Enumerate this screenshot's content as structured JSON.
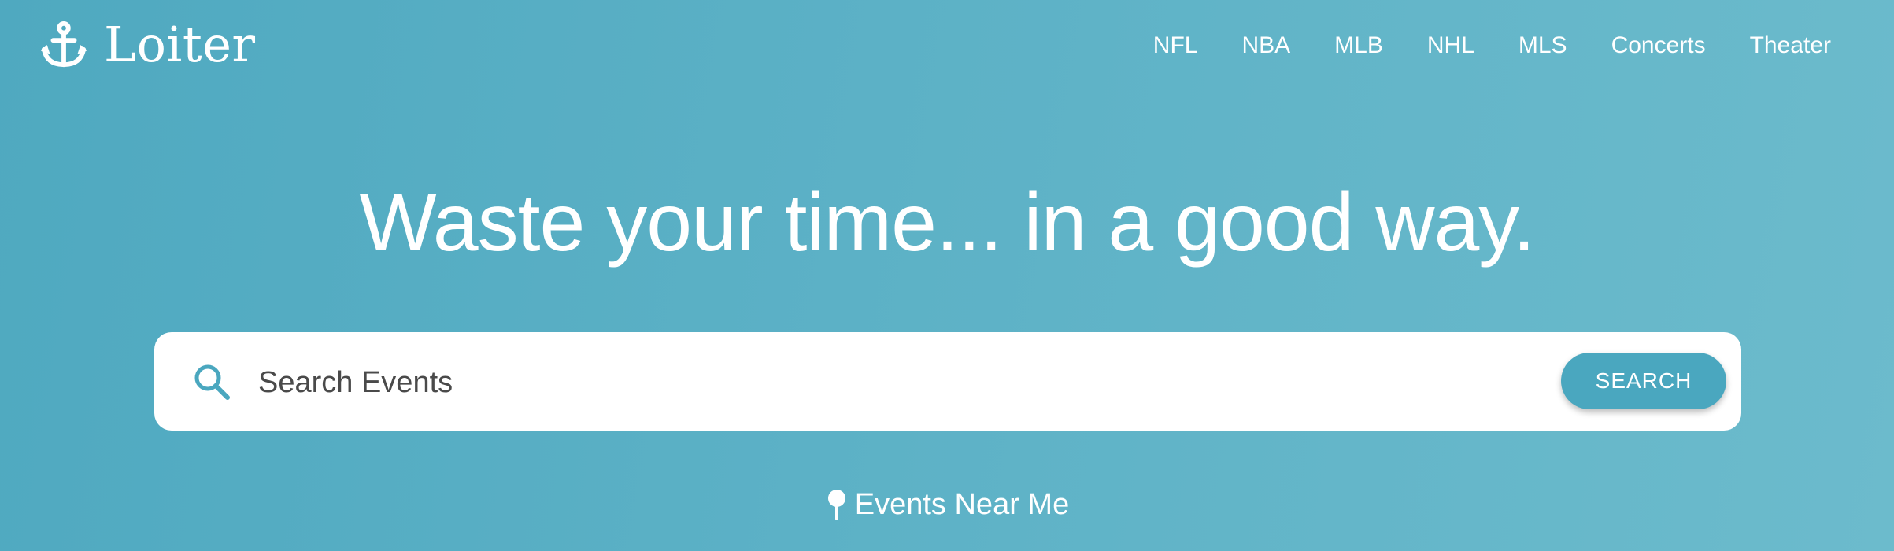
{
  "brand": {
    "name": "Loiter",
    "icon": "anchor-icon"
  },
  "nav": {
    "items": [
      "NFL",
      "NBA",
      "MLB",
      "NHL",
      "MLS",
      "Concerts",
      "Theater"
    ]
  },
  "hero": {
    "title": "Waste your time... in a good way."
  },
  "search": {
    "placeholder": "Search Events",
    "value": "",
    "button_label": "SEARCH",
    "icon": "search-icon"
  },
  "near_me": {
    "label": "Events Near Me",
    "icon": "pin-icon"
  },
  "colors": {
    "background": "#5cb1c6",
    "accent": "#4aa7bf",
    "text": "#ffffff",
    "input_text": "#4a4a4a"
  }
}
